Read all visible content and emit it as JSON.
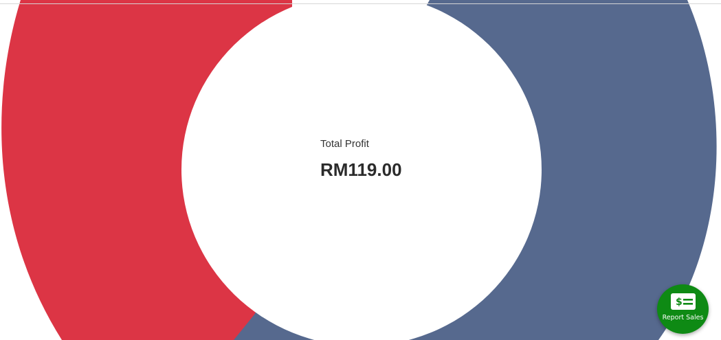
{
  "summary": {
    "label": "Total Profit",
    "value": "RM119.00"
  },
  "chart_data": {
    "type": "pie",
    "colors": [
      "#dc3545",
      "#56698e"
    ]
  },
  "fab": {
    "label": "Report Sales",
    "icon": "dollar-receipt-icon",
    "color": "#0e8a14"
  }
}
